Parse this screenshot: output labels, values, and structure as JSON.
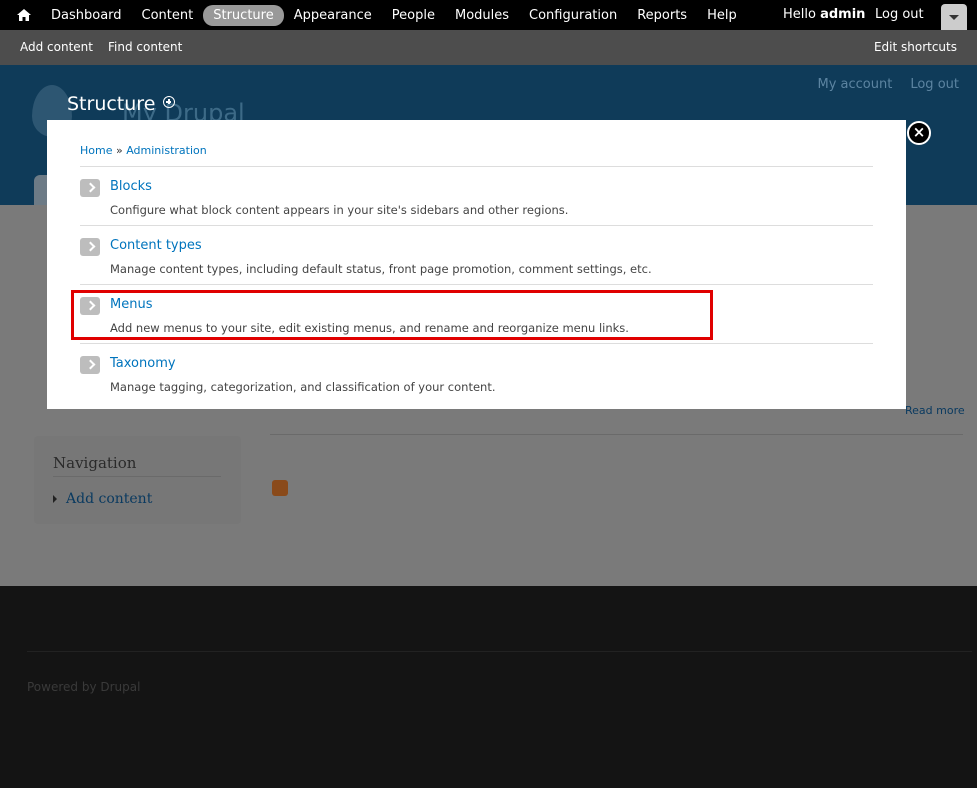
{
  "toolbar": {
    "home_icon": "home-icon",
    "menu": [
      {
        "label": "Dashboard",
        "active": false
      },
      {
        "label": "Content",
        "active": false
      },
      {
        "label": "Structure",
        "active": true
      },
      {
        "label": "Appearance",
        "active": false
      },
      {
        "label": "People",
        "active": false
      },
      {
        "label": "Modules",
        "active": false
      },
      {
        "label": "Configuration",
        "active": false
      },
      {
        "label": "Reports",
        "active": false
      },
      {
        "label": "Help",
        "active": false
      }
    ],
    "hello": "Hello",
    "username": "admin",
    "logout": "Log out",
    "drawer_icon": "chevron-down-icon"
  },
  "shortcuts": {
    "add_content": "Add content",
    "find_content": "Find content",
    "edit_shortcuts": "Edit shortcuts"
  },
  "header": {
    "site_name": "My Drupal",
    "my_account": "My account",
    "log_out": "Log out"
  },
  "page": {
    "title": "Structure"
  },
  "sidebar": {
    "heading": "Navigation",
    "item": "Add content"
  },
  "content": {
    "read_more": "Read more"
  },
  "footer": {
    "powered": "Powered by Drupal"
  },
  "modal": {
    "breadcrumb": {
      "home": "Home",
      "separator": " » ",
      "admin": "Administration"
    },
    "items": [
      {
        "title": "Blocks",
        "desc": "Configure what block content appears in your site's sidebars and other regions."
      },
      {
        "title": "Content types",
        "desc": "Manage content types, including default status, front page promotion, comment settings, etc."
      },
      {
        "title": "Menus",
        "desc": "Add new menus to your site, edit existing menus, and rename and reorganize menu links."
      },
      {
        "title": "Taxonomy",
        "desc": "Manage tagging, categorization, and classification of your content."
      }
    ],
    "close_glyph": "×"
  },
  "colors": {
    "link": "#0074bd",
    "highlight": "#e00000",
    "toolbar_active": "#999999"
  }
}
